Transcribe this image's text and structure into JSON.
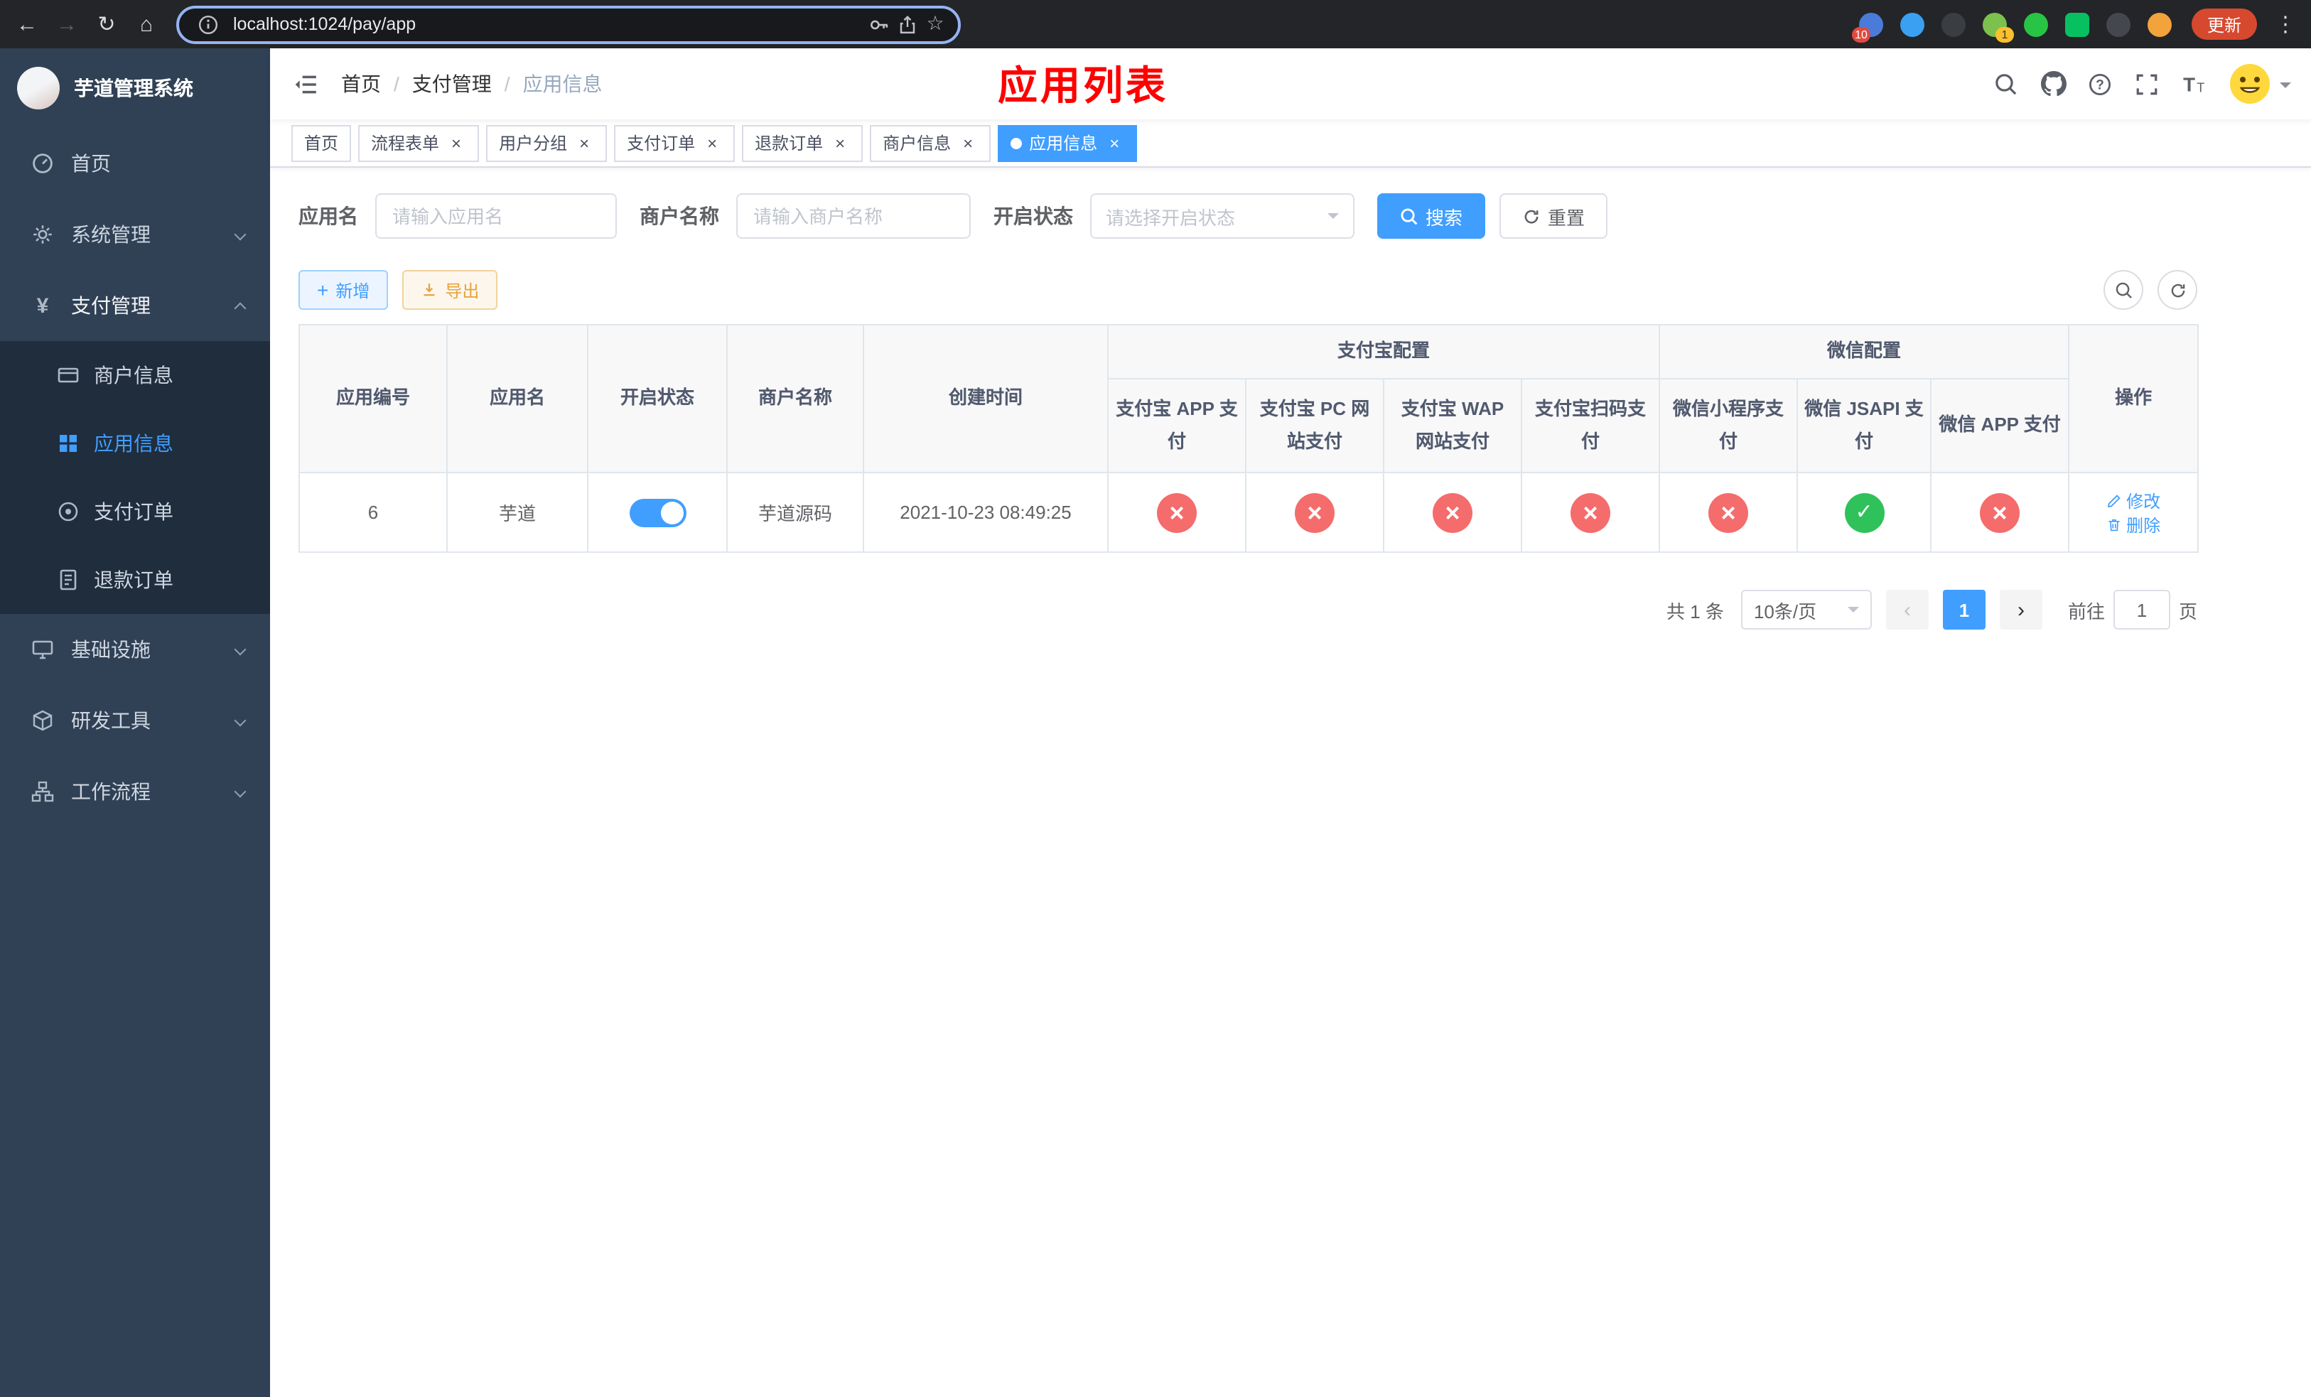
{
  "browser": {
    "url": "localhost:1024/pay/app",
    "update_label": "更新",
    "extensions_badge": "10",
    "extension_badge_one": "1"
  },
  "sidebar": {
    "logo_title": "芋道管理系统",
    "menu": [
      {
        "label": "首页"
      },
      {
        "label": "系统管理"
      },
      {
        "label": "支付管理"
      },
      {
        "label": "基础设施"
      },
      {
        "label": "研发工具"
      },
      {
        "label": "工作流程"
      }
    ],
    "payment_submenu": [
      {
        "label": "商户信息",
        "active": false
      },
      {
        "label": "应用信息",
        "active": true
      },
      {
        "label": "支付订单",
        "active": false
      },
      {
        "label": "退款订单",
        "active": false
      }
    ]
  },
  "navbar": {
    "breadcrumb": [
      {
        "label": "首页"
      },
      {
        "label": "支付管理"
      },
      {
        "label": "应用信息"
      }
    ],
    "page_title": "应用列表"
  },
  "tabs": [
    {
      "label": "首页",
      "active": false
    },
    {
      "label": "流程表单",
      "active": false
    },
    {
      "label": "用户分组",
      "active": false
    },
    {
      "label": "支付订单",
      "active": false
    },
    {
      "label": "退款订单",
      "active": false
    },
    {
      "label": "商户信息",
      "active": false
    },
    {
      "label": "应用信息",
      "active": true
    }
  ],
  "filters": {
    "app_name": {
      "label": "应用名",
      "placeholder": "请输入应用名",
      "value": ""
    },
    "merchant_name": {
      "label": "商户名称",
      "placeholder": "请输入商户名称",
      "value": ""
    },
    "status": {
      "label": "开启状态",
      "placeholder": "请选择开启状态"
    },
    "search_label": "搜索",
    "reset_label": "重置"
  },
  "toolbar": {
    "add_label": "新增",
    "export_label": "导出"
  },
  "table": {
    "columns": {
      "app_id": "应用编号",
      "app_name": "应用名",
      "enabled": "开启状态",
      "merchant_name": "商户名称",
      "create_time": "创建时间",
      "ops": "操作"
    },
    "alipay_group": "支付宝配置",
    "wechat_group": "微信配置",
    "alipay_columns": [
      "支付宝 APP 支付",
      "支付宝 PC 网站支付",
      "支付宝 WAP 网站支付",
      "支付宝扫码支付"
    ],
    "wechat_columns": [
      "微信小程序支付",
      "微信 JSAPI 支付",
      "微信 APP 支付"
    ],
    "rows": [
      {
        "app_id": "6",
        "app_name": "芋道",
        "enabled": "on",
        "merchant_name": "芋道源码",
        "create_time": "2021-10-23 08:49:25",
        "alipay_app": "no",
        "alipay_pc": "no",
        "alipay_wap": "no",
        "alipay_qr": "no",
        "wechat_mini": "no",
        "wechat_jsapi": "yes",
        "wechat_app": "no",
        "edit_label": "修改",
        "delete_label": "删除"
      }
    ]
  },
  "pagination": {
    "total": "共 1 条",
    "page_size": "10条/页",
    "page": "1",
    "goto_label": "前往",
    "goto_value": "1",
    "goto_suffix": "页"
  },
  "colors": {
    "primary": "#409eff",
    "danger": "#f56c6c",
    "success": "#2fc25b",
    "warning": "#e6a23c",
    "title_red": "#ff0000",
    "sidebar_bg": "#304156",
    "submenu_bg": "#1f2d3d"
  }
}
